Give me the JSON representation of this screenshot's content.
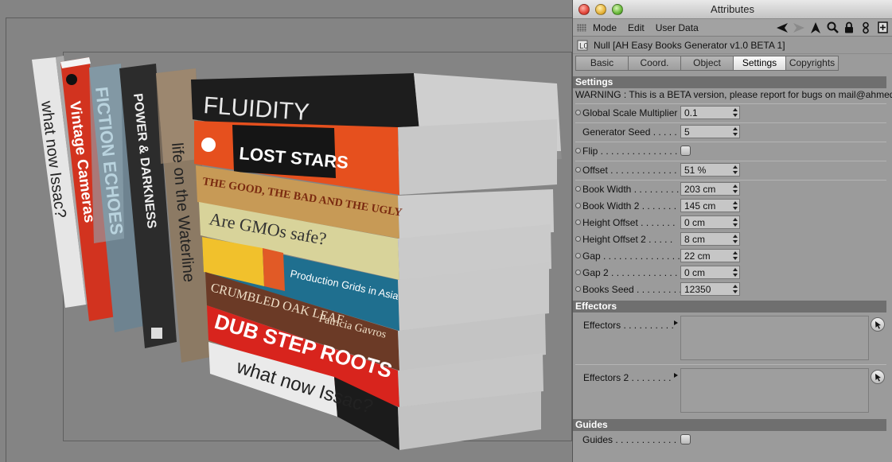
{
  "window": {
    "title": "Attributes"
  },
  "menu": {
    "items": [
      "Mode",
      "Edit",
      "User Data"
    ]
  },
  "toolbar_icons": [
    "back-arrow-icon",
    "forward-arrow-icon",
    "up-arrow-icon",
    "search-icon",
    "lock-icon",
    "link-icon",
    "new-window-icon"
  ],
  "object": {
    "title": "Null [AH Easy Books Generator v1.0 BETA 1]"
  },
  "tabs": [
    {
      "label": "Basic",
      "active": false
    },
    {
      "label": "Coord.",
      "active": false
    },
    {
      "label": "Object",
      "active": false
    },
    {
      "label": "Settings",
      "active": true
    },
    {
      "label": "Copyrights",
      "active": false
    }
  ],
  "settings": {
    "header": "Settings",
    "warning": "WARNING : This is a BETA version, please report for bugs on mail@ahmed",
    "global_scale": {
      "label": "Global Scale Multiplier",
      "value": "0.1"
    },
    "generator_seed": {
      "label": "Generator Seed . . . . .",
      "value": "5"
    },
    "flip": {
      "label": "Flip . . . . . . . . . . . . . . . ."
    },
    "offset": {
      "label": "Offset . . . . . . . . . . . . .",
      "value": "51 %"
    },
    "fields": [
      {
        "label": "Book Width . . . . . . . . .",
        "value": "203 cm"
      },
      {
        "label": "Book Width 2 . . . . . . .",
        "value": "145 cm"
      },
      {
        "label": "Height Offset . . . . . . .",
        "value": "0 cm"
      },
      {
        "label": "Height Offset 2 . . . . .",
        "value": "8 cm"
      },
      {
        "label": "Gap . . . . . . . . . . . . . . .",
        "value": "22 cm"
      },
      {
        "label": "Gap 2 . . . . . . . . . . . . .",
        "value": "0 cm"
      },
      {
        "label": "Books Seed . . . . . . . . .",
        "value": "12350"
      }
    ]
  },
  "effectors": {
    "header": "Effectors",
    "effectors": {
      "label": "Effectors . . . . . . . . . ."
    },
    "effectors2": {
      "label": "Effectors 2 . . . . . . . ."
    }
  },
  "guides": {
    "header": "Guides",
    "guides": {
      "label": "Guides . . . . . . . . . . . ."
    }
  },
  "viewport": {
    "spines_vertical": [
      "what now Issac?",
      "Vintage Cameras",
      "FICTION ECHOES",
      "POWER & DARKNESS",
      "life on the Waterline"
    ],
    "books": [
      "FLUIDITY",
      "LOST STARS",
      "THE GOOD, THE BAD AND THE UGLY",
      "Are GMOs safe?",
      "Production Grids in Asia",
      "CRUMBLED OAK LEAF",
      "Patricia Gavros",
      "DUB STEP ROOTS",
      "what now Issac?"
    ]
  }
}
